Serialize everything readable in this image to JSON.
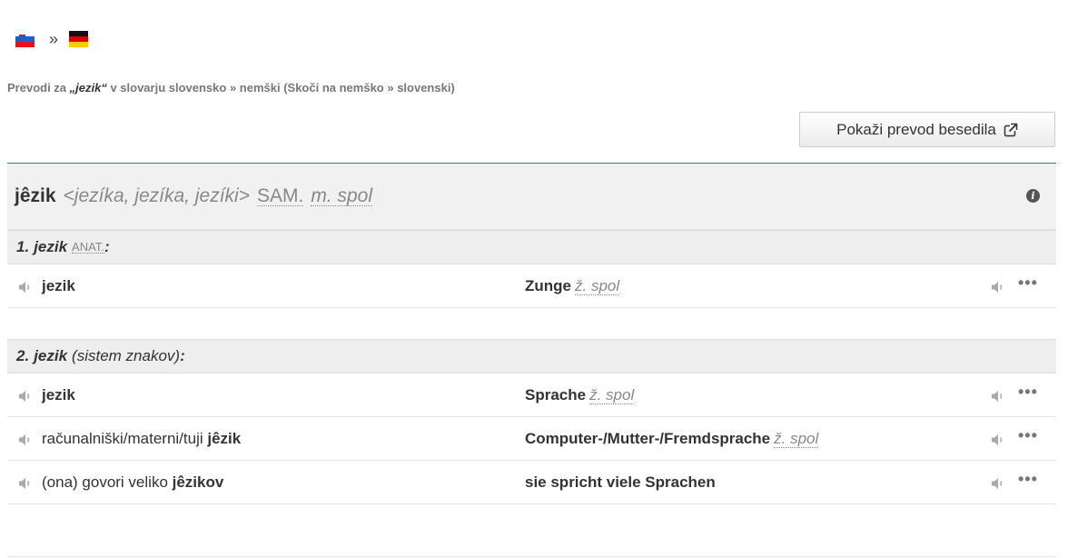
{
  "header": {
    "source_flag": "slovenian-flag",
    "target_flag": "german-flag",
    "separator": "»"
  },
  "subtitle": {
    "prefix": "Prevodi za ",
    "term": "„jezik“",
    "suffix": " v slovarju slovensko » nemški (Skoči na nemško » slovenski)"
  },
  "show_translation_button": {
    "label": "Pokaži prevod besedila"
  },
  "entry": {
    "headword": "jêzik",
    "forms": "<jezíka, jezíka, jezíki>",
    "pos": "SAM.",
    "gender": "m. spol"
  },
  "senses": [
    {
      "number": "1.",
      "word": "jezik",
      "domain": "ANAT.",
      "gloss": "",
      "rows": [
        {
          "src_pre": "",
          "src_bold": "jezik",
          "src_post": "",
          "tgt": "Zunge",
          "gram": "ž. spol"
        }
      ]
    },
    {
      "number": "2.",
      "word": "jezik",
      "domain": "",
      "gloss": "(sistem znakov)",
      "rows": [
        {
          "src_pre": "",
          "src_bold": "jezik",
          "src_post": "",
          "tgt": "Sprache",
          "gram": "ž. spol"
        },
        {
          "src_pre": "računalniški/materni/tuji ",
          "src_bold": "jêzik",
          "src_post": "",
          "tgt": "Computer-/Mutter-/Fremdsprache",
          "gram": "ž. spol"
        },
        {
          "src_pre": "(ona) govori veliko ",
          "src_bold": "jêzikov",
          "src_post": "",
          "tgt": "sie spricht viele Sprachen",
          "gram": ""
        }
      ]
    }
  ],
  "colors": {
    "accent_rule": "#2e8b57",
    "header_bg": "#f1f1f1"
  },
  "icons": {
    "speaker": "speaker-icon",
    "more": "more-options-icon",
    "info": "info-icon",
    "external": "external-link-icon"
  }
}
